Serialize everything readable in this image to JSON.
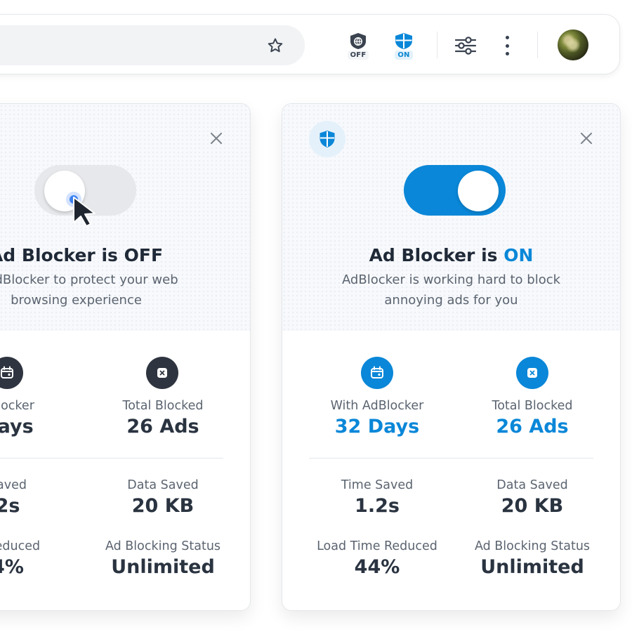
{
  "toolbar": {
    "extension_off_label": "OFF",
    "extension_on_label": "ON"
  },
  "card_off": {
    "title_prefix": "Ad Blocker is ",
    "title_state": "OFF",
    "subtitle_line1": "n AdBlocker to protect your web",
    "subtitle_line2": "browsing experience",
    "stats": [
      {
        "label": "dBlocker",
        "value": "Days"
      },
      {
        "label": "Total Blocked",
        "value": "26 Ads"
      },
      {
        "label": "Saved",
        "value": "2s"
      },
      {
        "label": "Data Saved",
        "value": "20 KB"
      },
      {
        "label": "e Reduced",
        "value": "4%"
      },
      {
        "label": "Ad Blocking Status",
        "value": "Unlimited"
      }
    ]
  },
  "card_on": {
    "title_prefix": "Ad Blocker is ",
    "title_state": "ON",
    "subtitle_line1": "AdBlocker is working hard to block",
    "subtitle_line2": "annoying ads for you",
    "stats": [
      {
        "label": "With AdBlocker",
        "value": "32 Days"
      },
      {
        "label": "Total Blocked",
        "value": "26 Ads"
      },
      {
        "label": "Time Saved",
        "value": "1.2s"
      },
      {
        "label": "Data Saved",
        "value": "20 KB"
      },
      {
        "label": "Load Time Reduced",
        "value": "44%"
      },
      {
        "label": "Ad Blocking Status",
        "value": "Unlimited"
      }
    ]
  },
  "colors": {
    "accent": "#0a87d8",
    "dark_icon": "#2e3440",
    "toggle_off": "#e6e8eb"
  },
  "icons": {
    "bookmark": "star-icon",
    "extension_off": "shield-globe-icon",
    "extension_on": "shield-icon",
    "settings": "sliders-icon",
    "menu": "kebab-menu-icon",
    "close": "close-icon",
    "days": "calendar-icon",
    "blocked": "blocked-x-icon"
  }
}
